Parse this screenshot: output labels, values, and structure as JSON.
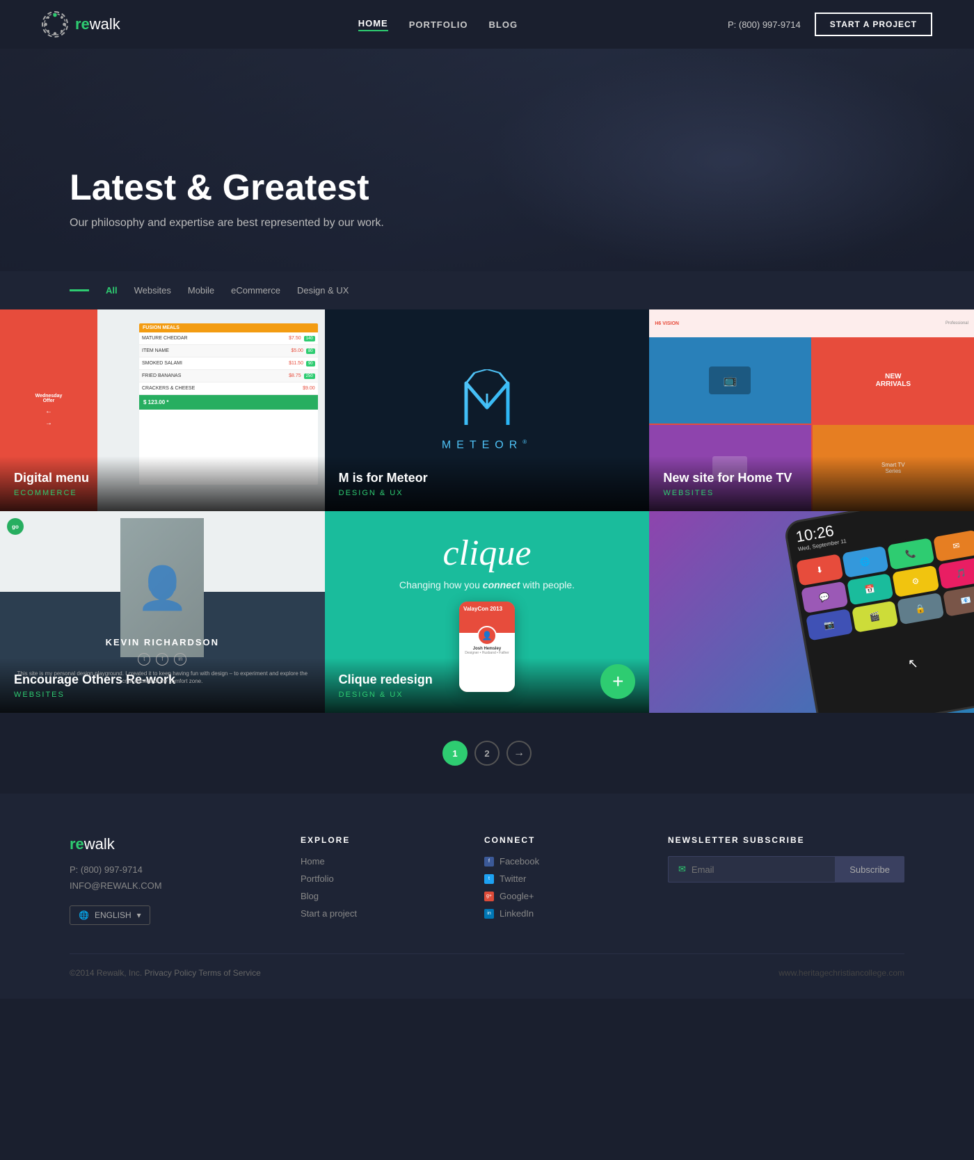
{
  "header": {
    "logo_re": "re",
    "logo_walk": "walk",
    "nav": [
      "HOME",
      "PORTFOLIO",
      "BLOG"
    ],
    "active_nav": "PORTFOLIO",
    "phone": "P: (800) 997-9714",
    "cta_label": "START A PROJECT"
  },
  "hero": {
    "title": "Latest & Greatest",
    "subtitle": "Our philosophy and expertise are best represented by our work."
  },
  "filters": {
    "items": [
      "All",
      "Websites",
      "Mobile",
      "eCommerce",
      "Design & UX"
    ],
    "active": "All"
  },
  "portfolio": {
    "items": [
      {
        "id": "digital-menu",
        "title": "Digital menu",
        "category": "ECOMMERCE"
      },
      {
        "id": "meteor",
        "title": "M is for Meteor",
        "category": "DESIGN & UX"
      },
      {
        "id": "home-tv",
        "title": "New site for Home TV",
        "category": "WEBSITES"
      },
      {
        "id": "kevin",
        "title": "Encourage Others Re-work",
        "category": "WEBSITES"
      },
      {
        "id": "clique",
        "title": "Clique redesign",
        "category": "DESIGN & UX"
      },
      {
        "id": "htc",
        "title": "",
        "category": ""
      }
    ]
  },
  "pagination": {
    "pages": [
      "1",
      "2"
    ],
    "active": "1",
    "next_label": "→"
  },
  "footer": {
    "logo_re": "re",
    "logo_walk": "walk",
    "phone": "P: (800) 997-9714",
    "email": "INFO@REWALK.COM",
    "lang": "ENGLISH",
    "explore_title": "EXPLORE",
    "explore_links": [
      "Home",
      "Portfolio",
      "Blog",
      "Start a project"
    ],
    "connect_title": "CONNECT",
    "connect_links": [
      "Facebook",
      "Twitter",
      "Google+",
      "LinkedIn"
    ],
    "newsletter_title": "NEWSLETTER SUBSCRIBE",
    "email_placeholder": "Email",
    "subscribe_label": "Subscribe",
    "copyright": "©2014 Rewalk, Inc.",
    "privacy": "Privacy Policy",
    "terms": "Terms of Service",
    "footer_url": "www.heritagechristiancollege.com"
  },
  "clique": {
    "title": "clique",
    "subtitle_pre": "Changing how you ",
    "subtitle_em": "connect",
    "subtitle_post": " with people."
  },
  "meteor_text": "METEOR",
  "htc_time": "10:26",
  "htc_date": "Wed, September 11",
  "kevin_name": "KEVIN RICHARDSON"
}
